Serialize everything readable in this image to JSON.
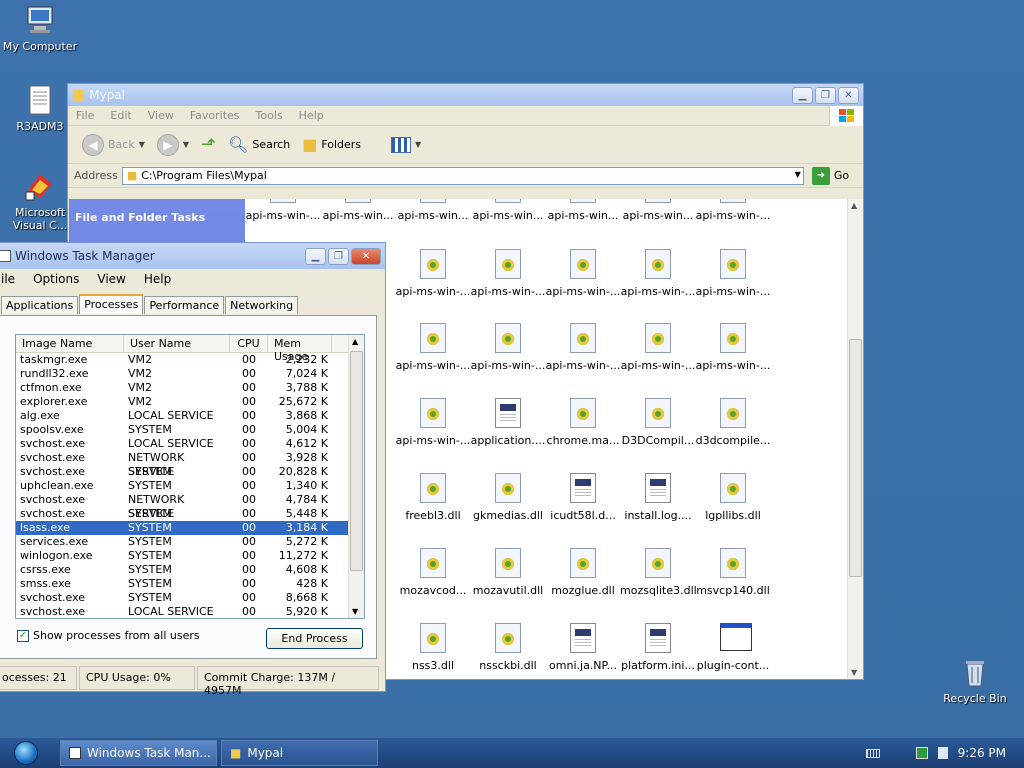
{
  "desktop": {
    "icons": [
      {
        "label": "My Computer"
      },
      {
        "label": "R3ADM3"
      },
      {
        "label": "Microsoft Visual C..."
      },
      {
        "label": "Recycle Bin"
      }
    ]
  },
  "explorer": {
    "title": "Mypal",
    "menu": [
      "File",
      "Edit",
      "View",
      "Favorites",
      "Tools",
      "Help"
    ],
    "toolbar": {
      "back": "Back",
      "search": "Search",
      "folders": "Folders"
    },
    "address_label": "Address",
    "address_value": "C:\\Program Files\\Mypal",
    "go_label": "Go",
    "task_heading": "File and Folder Tasks",
    "file_rows": [
      [
        "api-ms-win-...",
        "api-ms-win...",
        "api-ms-win...",
        "api-ms-win...",
        "api-ms-win...",
        "api-ms-win...",
        "api-ms-win-..."
      ],
      [
        "api-ms-win-...",
        "api-ms-win-...",
        "api-ms-win-...",
        "api-ms-win-...",
        "api-ms-win-..."
      ],
      [
        "api-ms-win-...",
        "api-ms-win-...",
        "api-ms-win-...",
        "api-ms-win-...",
        "api-ms-win-..."
      ],
      [
        "api-ms-win-...",
        "application....",
        "chrome.ma...",
        "D3DCompil...",
        "d3dcompile..."
      ],
      [
        "freebl3.dll",
        "gkmedias.dll",
        "icudt58l.d...",
        "install.log....",
        "lgpllibs.dll"
      ],
      [
        "mozavcod...",
        "mozavutil.dll",
        "mozglue.dll",
        "mozsqlite3.dll",
        "msvcp140.dll"
      ],
      [
        "nss3.dll",
        "nssckbi.dll",
        "omni.ja.NP...",
        "platform.ini...",
        "plugin-cont..."
      ]
    ]
  },
  "taskmgr": {
    "title": "Windows Task Manager",
    "menu": [
      "ile",
      "Options",
      "View",
      "Help"
    ],
    "tabs": [
      "Applications",
      "Processes",
      "Performance",
      "Networking"
    ],
    "active_tab": "Processes",
    "columns": [
      "Image Name",
      "User Name",
      "CPU",
      "Mem Usage"
    ],
    "processes": [
      [
        "taskmgr.exe",
        "VM2",
        "00",
        "2,232 K"
      ],
      [
        "rundll32.exe",
        "VM2",
        "00",
        "7,024 K"
      ],
      [
        "ctfmon.exe",
        "VM2",
        "00",
        "3,788 K"
      ],
      [
        "explorer.exe",
        "VM2",
        "00",
        "25,672 K"
      ],
      [
        "alg.exe",
        "LOCAL SERVICE",
        "00",
        "3,868 K"
      ],
      [
        "spoolsv.exe",
        "SYSTEM",
        "00",
        "5,004 K"
      ],
      [
        "svchost.exe",
        "LOCAL SERVICE",
        "00",
        "4,612 K"
      ],
      [
        "svchost.exe",
        "NETWORK SERVICE",
        "00",
        "3,928 K"
      ],
      [
        "svchost.exe",
        "SYSTEM",
        "00",
        "20,828 K"
      ],
      [
        "uphclean.exe",
        "SYSTEM",
        "00",
        "1,340 K"
      ],
      [
        "svchost.exe",
        "NETWORK SERVICE",
        "00",
        "4,784 K"
      ],
      [
        "svchost.exe",
        "SYSTEM",
        "00",
        "5,448 K"
      ],
      [
        "lsass.exe",
        "SYSTEM",
        "00",
        "3,184 K"
      ],
      [
        "services.exe",
        "SYSTEM",
        "00",
        "5,272 K"
      ],
      [
        "winlogon.exe",
        "SYSTEM",
        "00",
        "11,272 K"
      ],
      [
        "csrss.exe",
        "SYSTEM",
        "00",
        "4,608 K"
      ],
      [
        "smss.exe",
        "SYSTEM",
        "00",
        "428 K"
      ],
      [
        "svchost.exe",
        "SYSTEM",
        "00",
        "8,668 K"
      ],
      [
        "svchost.exe",
        "LOCAL SERVICE",
        "00",
        "5,920 K"
      ]
    ],
    "selected_index": 12,
    "show_all_label": "Show processes from all users",
    "end_process_label": "End Process",
    "status_processes": "ocesses: 21",
    "status_cpu": "CPU Usage: 0%",
    "status_commit": "Commit Charge: 137M / 4957M"
  },
  "taskbar": {
    "buttons": [
      "Windows Task Man...",
      "Mypal"
    ],
    "clock": "9:26 PM"
  }
}
